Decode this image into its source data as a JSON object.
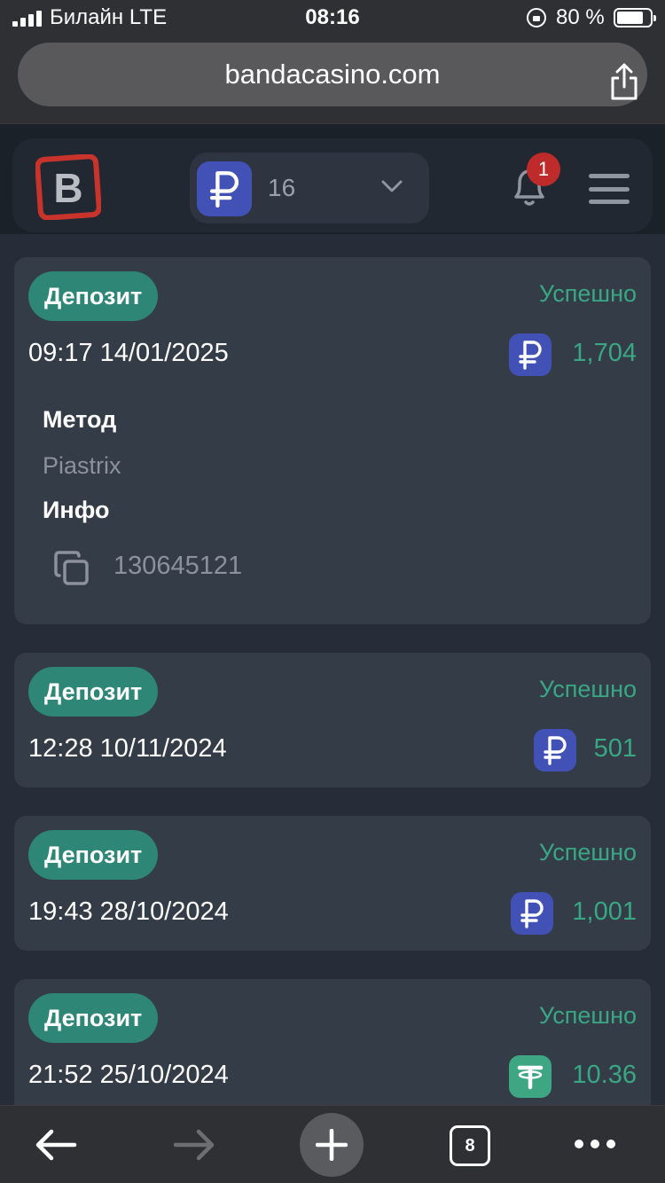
{
  "status_bar": {
    "carrier": "Билайн  LTE",
    "time": "08:16",
    "battery": "80 %"
  },
  "browser": {
    "url": "bandacasino.com",
    "tabs_count": "8"
  },
  "header": {
    "balance": "16",
    "notifications": "1",
    "currency_icon": "ruble-icon"
  },
  "transactions": [
    {
      "type": "Депозит",
      "status": "Успешно",
      "datetime": "09:17 14/01/2025",
      "amount": "1,704",
      "currency": "RUB",
      "method_label": "Метод",
      "method": "Piastrix",
      "info_label": "Инфо",
      "info": "130645121"
    },
    {
      "type": "Депозит",
      "status": "Успешно",
      "datetime": "12:28 10/11/2024",
      "amount": "501",
      "currency": "RUB"
    },
    {
      "type": "Депозит",
      "status": "Успешно",
      "datetime": "19:43 28/10/2024",
      "amount": "1,001",
      "currency": "RUB"
    },
    {
      "type": "Депозит",
      "status": "Успешно",
      "datetime": "21:52 25/10/2024",
      "amount": "10.36",
      "currency": "USDT"
    }
  ],
  "colors": {
    "accent_green": "#2e8776",
    "success_text": "#39a784",
    "ruble_badge": "#4151b6",
    "tether_badge": "#3fa683",
    "notification_badge": "#bf2a2a",
    "card_bg": "#343c48"
  }
}
